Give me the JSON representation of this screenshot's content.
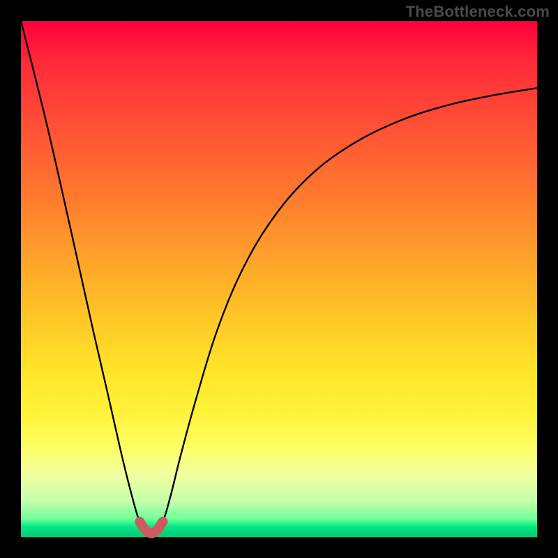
{
  "watermark": "TheBottleneck.com",
  "chart_data": {
    "type": "line",
    "title": "",
    "xlabel": "",
    "ylabel": "",
    "xlim": [
      0,
      100
    ],
    "ylim": [
      0,
      100
    ],
    "series": [
      {
        "name": "bottleneck-curve",
        "x": [
          0,
          5,
          10,
          14,
          17,
          19.5,
          21.5,
          23,
          24.5,
          26,
          27.5,
          29,
          31,
          34,
          38,
          43,
          49,
          56,
          64,
          73,
          82,
          91,
          100
        ],
        "values": [
          100,
          80,
          58,
          40,
          27,
          16,
          8,
          3,
          1,
          1,
          3,
          8,
          16,
          27,
          40,
          52,
          62,
          70,
          76,
          80.5,
          83.5,
          85.5,
          87
        ]
      }
    ],
    "marker_region": {
      "name": "optimal-zone",
      "color": "#cc5a60",
      "x_range": [
        22,
        29
      ],
      "y_max": 6
    },
    "gradient_bands": [
      {
        "y": 100,
        "color": "#ff003a"
      },
      {
        "y": 50,
        "color": "#ffc826"
      },
      {
        "y": 10,
        "color": "#fdff5e"
      },
      {
        "y": 2,
        "color": "#00e884"
      }
    ]
  }
}
